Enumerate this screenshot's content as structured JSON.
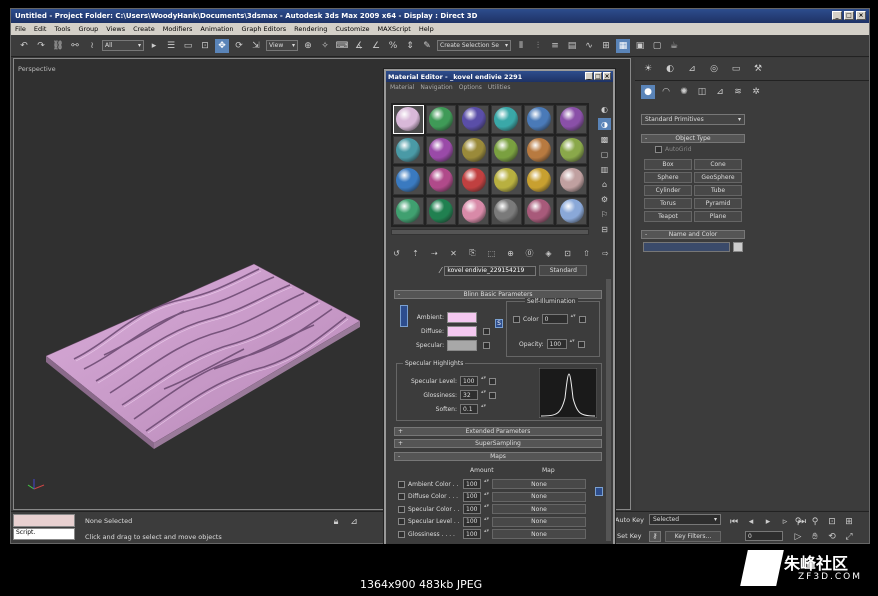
{
  "window": {
    "title": "Untitled      - Project Folder: C:\\Users\\WoodyHank\\Documents\\3dsmax      - Autodesk 3ds Max  2009 x64      - Display : Direct 3D",
    "min": "_",
    "max": "□",
    "close": "×"
  },
  "menu": [
    "File",
    "Edit",
    "Tools",
    "Group",
    "Views",
    "Create",
    "Modifiers",
    "Animation",
    "Graph Editors",
    "Rendering",
    "Customize",
    "MAXScript",
    "Help"
  ],
  "toolbar": {
    "selection_filter": "All",
    "ref_coord": "View",
    "named_sel": "Create Selection Se"
  },
  "viewport": {
    "label": "Perspective"
  },
  "command_panel": {
    "category": "Standard Primitives",
    "object_type_header": "Object Type",
    "autogrid": "AutoGrid",
    "objects": [
      "Box",
      "Cone",
      "Sphere",
      "GeoSphere",
      "Cylinder",
      "Tube",
      "Torus",
      "Pyramid",
      "Teapot",
      "Plane"
    ],
    "name_color_header": "Name and Color"
  },
  "status": {
    "script_label": "Script.",
    "selection": "None Selected",
    "prompt": "Click and drag to select and move objects",
    "autokey": "Auto Key",
    "setkey": "Set Key",
    "key_mode": "Selected",
    "key_filters": "Key Filters...",
    "frame": "0"
  },
  "material_editor": {
    "title": "Material Editor - _kovel endivie 2291",
    "menu": [
      "Material",
      "Navigation",
      "Options",
      "Utilities"
    ],
    "slot_colors": [
      "#d8b8d8",
      "#3f9a57",
      "#5a4ea8",
      "#3aa8a8",
      "#4a7ab8",
      "#8a50a8",
      "#4a9aa6",
      "#9a4aa8",
      "#9a8a3a",
      "#7aa040",
      "#b87a40",
      "#8aa84a",
      "#3a7ac0",
      "#b04a8a",
      "#c04040",
      "#b8b040",
      "#c8a030",
      "#c0a0a0",
      "#40a070",
      "#208050",
      "#d88aa8",
      "#7a7a7a",
      "#a85a7a",
      "#8aa8d8"
    ],
    "material_name": "kovel endivie_229154219",
    "material_type": "Standard",
    "blinn_header": "Blinn Basic Parameters",
    "self_illum_header": "Self-Illumination",
    "ambient_label": "Ambient:",
    "diffuse_label": "Diffuse:",
    "specular_label": "Specular:",
    "ambient_color": "#f4c8f0",
    "diffuse_color": "#f4c8f0",
    "specular_color": "#a8a8a8",
    "color_label": "Color",
    "color_value": "0",
    "opacity_label": "Opacity:",
    "opacity_value": "100",
    "spec_highlights_header": "Specular Highlights",
    "spec_level_label": "Specular Level:",
    "spec_level_value": "100",
    "glossiness_label": "Glossiness:",
    "glossiness_value": "32",
    "soften_label": "Soften:",
    "soften_value": "0.1",
    "extended_header": "Extended Parameters",
    "supersampling_header": "SuperSampling",
    "maps_header": "Maps",
    "amount_col": "Amount",
    "map_col": "Map",
    "maps": [
      {
        "label": "Ambient Color . .",
        "amount": "100",
        "map": "None"
      },
      {
        "label": "Diffuse Color . . .",
        "amount": "100",
        "map": "None"
      },
      {
        "label": "Specular Color . .",
        "amount": "100",
        "map": "None"
      },
      {
        "label": "Specular Level . .",
        "amount": "100",
        "map": "None"
      },
      {
        "label": "Glossiness . . . .",
        "amount": "100",
        "map": "None"
      }
    ]
  },
  "caption": "1364x900  483kb  JPEG",
  "watermark": {
    "cn": "朱峰社区",
    "url": "ZF3D.COM"
  }
}
